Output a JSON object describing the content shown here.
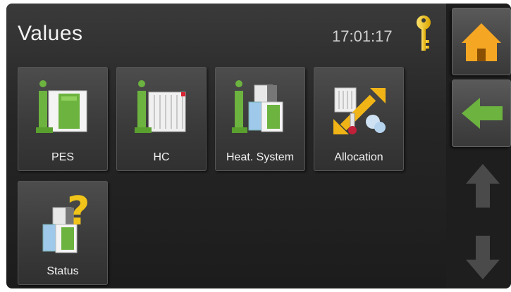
{
  "header": {
    "title": "Values",
    "time": "17:01:17"
  },
  "tiles": [
    {
      "label": "PES",
      "icon": "pes-module-icon"
    },
    {
      "label": "HC",
      "icon": "heating-circuit-icon"
    },
    {
      "label": "Heat. System",
      "icon": "heat-system-icon"
    },
    {
      "label": "Allocation",
      "icon": "allocation-icon"
    },
    {
      "label": "Status",
      "icon": "status-icon"
    }
  ],
  "nav": {
    "home_icon": "home-icon",
    "back_icon": "back-arrow-icon",
    "up_icon": "scroll-up-icon",
    "down_icon": "scroll-down-icon"
  },
  "colors": {
    "accent_green": "#6cb33f",
    "home_orange": "#f5a623",
    "key_yellow": "#f2c200",
    "help_yellow": "#f0c419"
  }
}
